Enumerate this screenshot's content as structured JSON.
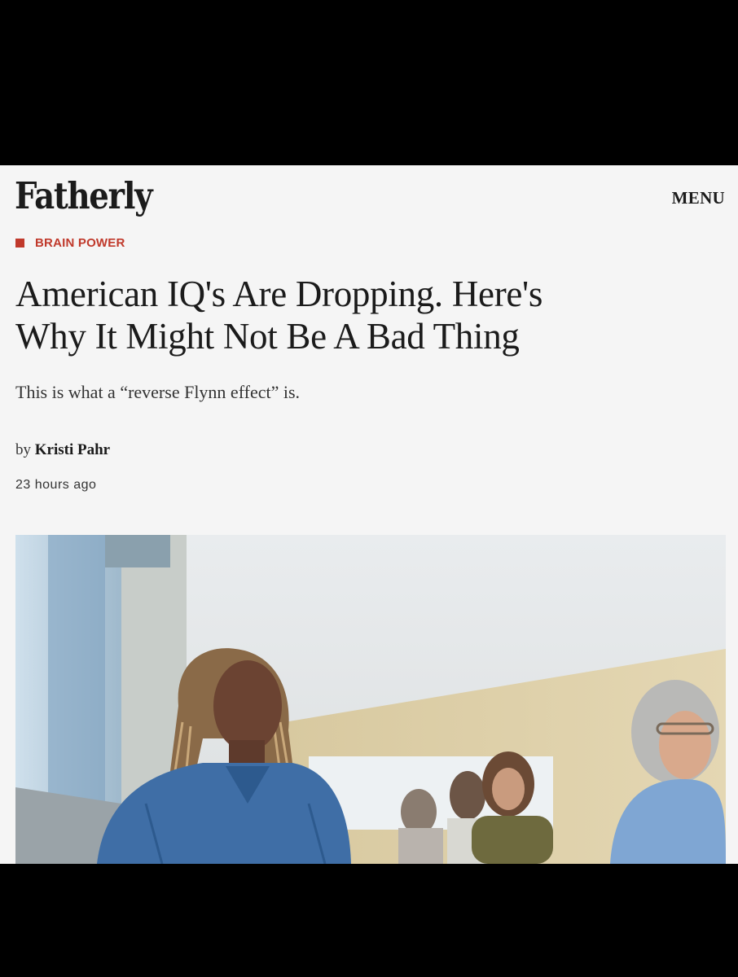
{
  "site": {
    "logo": "Fatherly",
    "menu_label": "MENU"
  },
  "article": {
    "category": "BRAIN POWER",
    "headline_line1": "American IQ's Are Dropping. Here's",
    "headline_line2": "Why It Might Not Be A Bad Thing",
    "dek": "This is what a “reverse Flynn effect” is.",
    "byline_prefix": "by",
    "author": "Kristi Pahr",
    "timestamp": "23 hours ago"
  },
  "colors": {
    "accent": "#c0392b",
    "page_background": "#f5f5f5",
    "text": "#1b1b1b"
  },
  "hero_image": {
    "description_icon": "photo-of-women-in-classroom"
  }
}
